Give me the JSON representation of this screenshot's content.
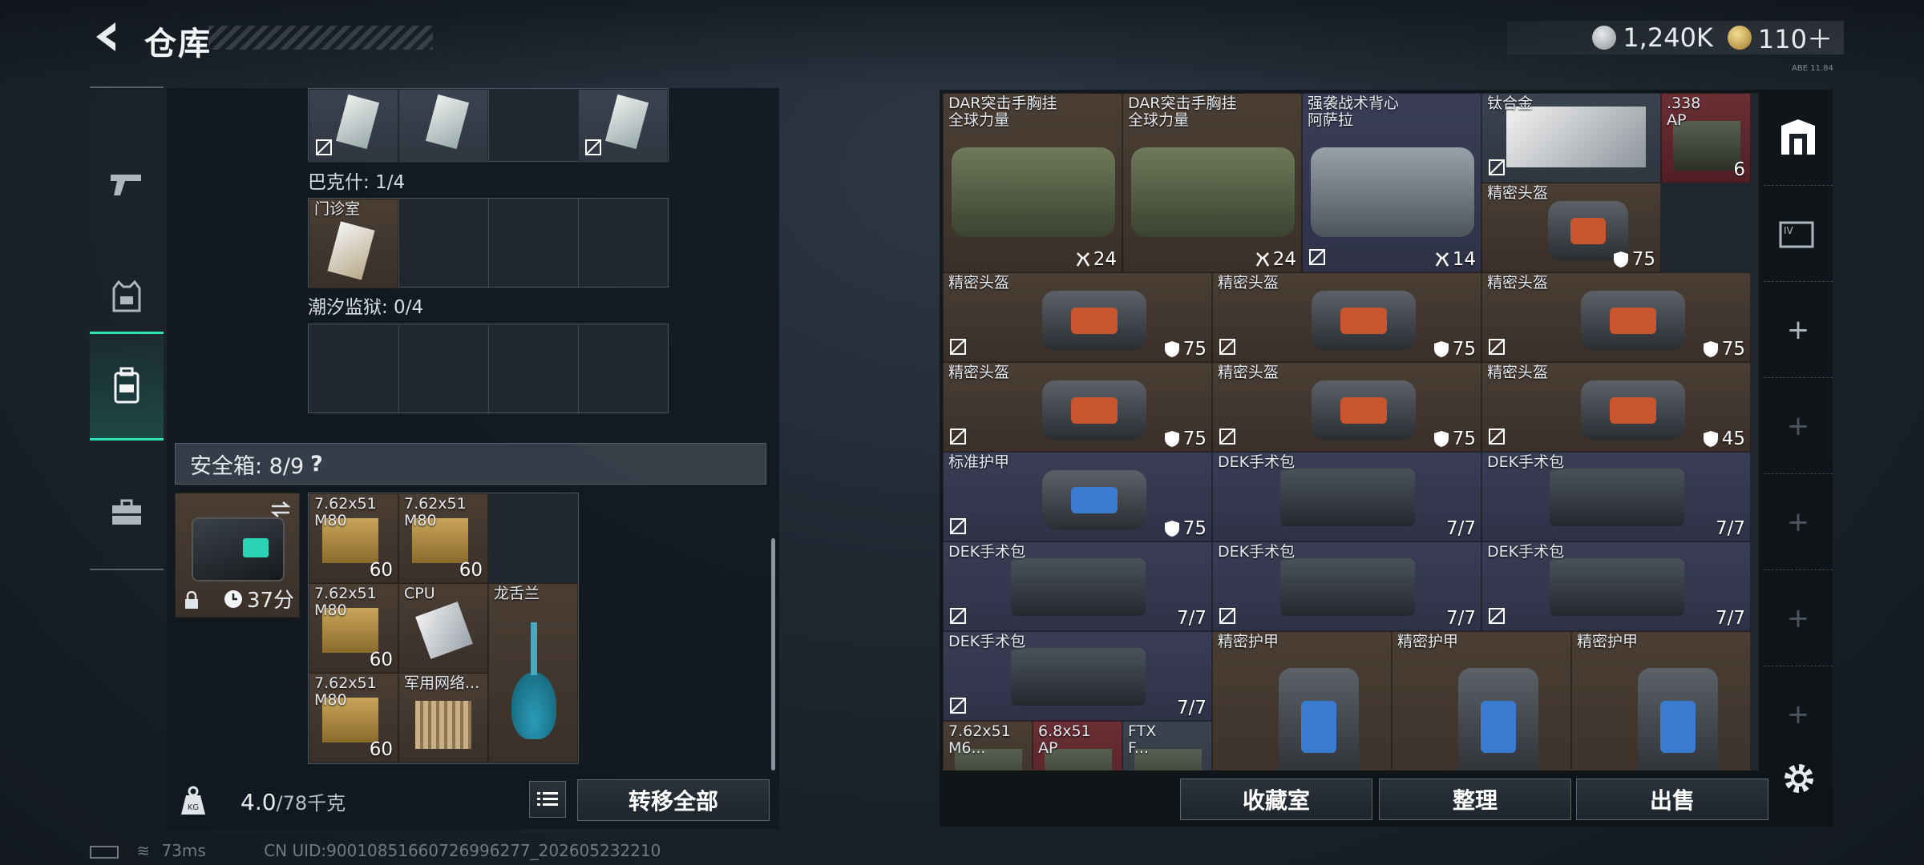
{
  "header": {
    "title": "仓库",
    "currency_silver": "1,240K",
    "currency_gold": "110＋",
    "build_tag": "ABE 11.84"
  },
  "left": {
    "bakesh_label": "巴克什: 1/4",
    "clinic_item": "门诊室",
    "prison_label": "潮汐监狱: 0/4",
    "safe_label": "安全箱: 8/9",
    "safe_help": "?",
    "safe_timer": "37分",
    "safe_items": [
      {
        "label": "7.62x51\nM80",
        "count": "60"
      },
      {
        "label": "7.62x51\nM80",
        "count": "60"
      },
      {
        "label": "7.62x51\nM80",
        "count": "60"
      },
      {
        "label": "CPU",
        "count": ""
      },
      {
        "label": "龙舌兰",
        "count": ""
      },
      {
        "label": "7.62x51\nM80",
        "count": "60"
      },
      {
        "label": "军用网络...",
        "count": ""
      }
    ],
    "weight_value": "4.0",
    "weight_max": "/78千克",
    "transfer_all": "转移全部"
  },
  "right": {
    "items": [
      {
        "label": "DAR突击手胸挂\n全球力量",
        "count": "24"
      },
      {
        "label": "DAR突击手胸挂\n全球力量",
        "count": "24"
      },
      {
        "label": "强袭战术背心\n阿萨拉",
        "count": "14"
      },
      {
        "label": "钛合金",
        "count": ""
      },
      {
        "label": ".338\nAP",
        "count": "6"
      },
      {
        "label": "精密头盔",
        "count": "75"
      },
      {
        "label": "精密头盔",
        "count": "75"
      },
      {
        "label": "精密头盔",
        "count": "75"
      },
      {
        "label": "精密头盔",
        "count": "75"
      },
      {
        "label": "精密头盔",
        "count": "75"
      },
      {
        "label": "精密头盔",
        "count": "75"
      },
      {
        "label": "精密头盔",
        "count": "45"
      },
      {
        "label": "标准护甲",
        "count": "75"
      },
      {
        "label": "DEK手术包",
        "count": "7/7"
      },
      {
        "label": "DEK手术包",
        "count": "7/7"
      },
      {
        "label": "DEK手术包",
        "count": "7/7"
      },
      {
        "label": "DEK手术包",
        "count": "7/7"
      },
      {
        "label": "DEK手术包",
        "count": "7/7"
      },
      {
        "label": "DEK手术包",
        "count": "7/7"
      },
      {
        "label": "精密护甲",
        "count": ""
      },
      {
        "label": "精密护甲",
        "count": ""
      },
      {
        "label": "精密护甲",
        "count": ""
      },
      {
        "label": "7.62x51\nM6...",
        "count": ""
      },
      {
        "label": "6.8x51\nAP",
        "count": ""
      },
      {
        "label": "FTX\nF...",
        "count": ""
      }
    ],
    "btn_collection": "收藏室",
    "btn_sort": "整理",
    "btn_sell": "出售"
  },
  "footer": {
    "ping": "73ms",
    "uid": "CN UID:90010851660726996277_202605232210"
  },
  "colors": {
    "accent": "#2ee3b5",
    "bg": "#1d252e"
  }
}
